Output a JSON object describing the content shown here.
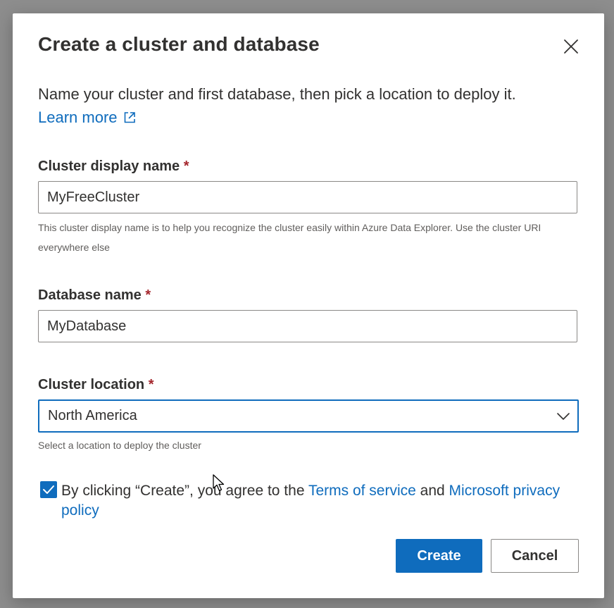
{
  "dialog": {
    "title": "Create a cluster and database",
    "description": "Name your cluster and first database, then pick a location to deploy it.",
    "learn_more": "Learn more",
    "close_icon": "close-icon",
    "external_link_icon": "external-link-icon"
  },
  "cluster_name": {
    "label": "Cluster display name",
    "required_mark": "*",
    "value": "MyFreeCluster",
    "helper": "This cluster display name is to help you recognize the cluster easily within Azure Data Explorer. Use the cluster URI everywhere else"
  },
  "database_name": {
    "label": "Database name",
    "required_mark": "*",
    "value": "MyDatabase"
  },
  "cluster_location": {
    "label": "Cluster location",
    "required_mark": "*",
    "selected": "North America",
    "helper": "Select a location to deploy the cluster",
    "chevron_icon": "chevron-down-icon"
  },
  "consent": {
    "checked": true,
    "text_before": "By clicking “Create”, you agree to the ",
    "terms_link": "Terms of service",
    "text_and": " and ",
    "privacy_link": "Microsoft privacy policy"
  },
  "buttons": {
    "create": "Create",
    "cancel": "Cancel"
  },
  "colors": {
    "accent": "#0f6cbd",
    "required": "#a4262c",
    "text": "#323130",
    "helper_text": "#605e5c",
    "overlay": "#8d8d8d"
  }
}
